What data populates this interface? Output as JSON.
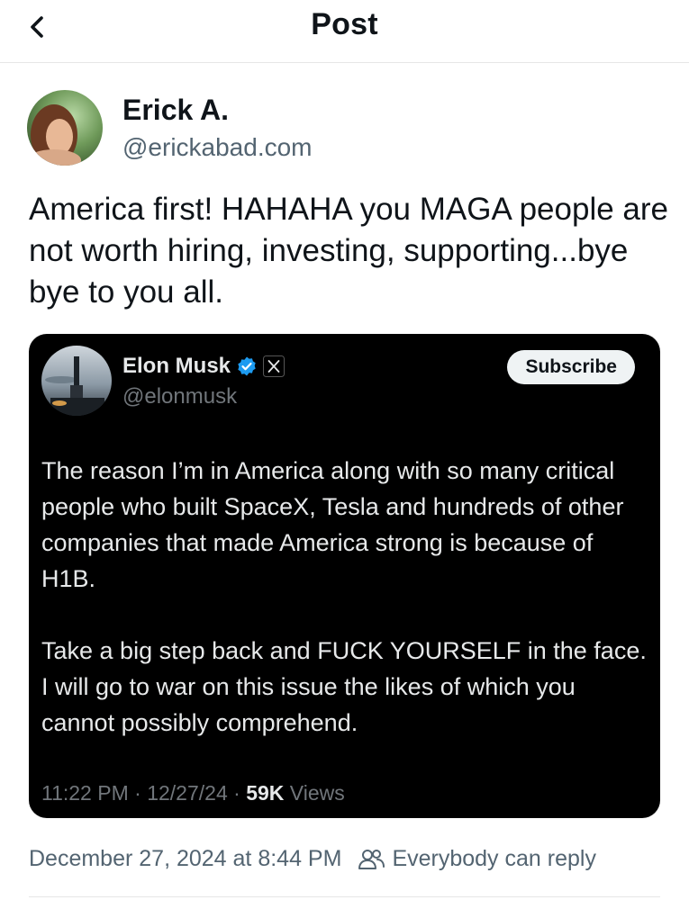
{
  "header": {
    "title": "Post"
  },
  "post": {
    "author_name": "Erick A.",
    "author_handle": "@erickabad.com",
    "text": "America first! HAHAHA you MAGA people are not worth hiring, investing, supporting...bye bye to you all.",
    "date": "December 27, 2024 at 8:44 PM",
    "reply_setting": "Everybody can reply"
  },
  "quote": {
    "author_name": "Elon Musk",
    "author_handle": "@elonmusk",
    "subscribe_label": "Subscribe",
    "paragraph1": "The reason I’m in America along with so many critical people who built SpaceX, Tesla and hundreds of other companies that made America strong is because of H1B.",
    "paragraph2": "Take a big step back and FUCK YOURSELF in the face. I will go to war on this issue the likes of which you cannot possibly comprehend.",
    "time": "11:22 PM",
    "date": "12/27/24",
    "views": "59K",
    "views_label": "Views",
    "sep": "·"
  },
  "colors": {
    "verified_badge": "#1d9bf0",
    "card_background": "#000000",
    "secondary_text": "#536471"
  },
  "icons": [
    "back-chevron-icon",
    "verified-badge-icon",
    "x-logo-icon",
    "people-icon"
  ]
}
